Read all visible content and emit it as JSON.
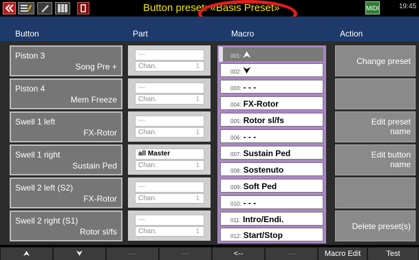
{
  "topbar": {
    "title_prefix": "Button preset: ",
    "preset_name": "«Basis Preset»",
    "b1_label": "",
    "b2_label": "EDIT",
    "b3_label": "",
    "right_icon": "MIDI",
    "clock": "19:45"
  },
  "headers": {
    "button": "Button",
    "part": "Part",
    "macro": "Macro",
    "action": "Action"
  },
  "buttons": [
    {
      "name": "Piston 3",
      "func": "Song Pre +"
    },
    {
      "name": "Piston 4",
      "func": "Mem Freeze"
    },
    {
      "name": "Swell 1 left",
      "func": "FX-Rotor"
    },
    {
      "name": "Swell 1 right",
      "func": "Sustain Ped"
    },
    {
      "name": "Swell 2 left  (S2)",
      "func": "FX-Rotor"
    },
    {
      "name": "Swell 2 right (S1)",
      "func": "Rotor sl/fs"
    }
  ],
  "parts": [
    {
      "part": "---",
      "chan": "Chan.",
      "num": "1"
    },
    {
      "part": "---",
      "chan": "Chan.",
      "num": "1"
    },
    {
      "part": "---",
      "chan": "Chan.",
      "num": "1"
    },
    {
      "part": "all Master",
      "chan": "Chan.",
      "num": "1"
    },
    {
      "part": "---",
      "chan": "Chan.",
      "num": "1"
    },
    {
      "part": "---",
      "chan": "Chan.",
      "num": "1"
    }
  ],
  "macros": [
    {
      "num": "001:",
      "text": "⮝"
    },
    {
      "num": "002:",
      "text": "⮟"
    },
    {
      "num": "003:",
      "text": " - - -"
    },
    {
      "num": "004:",
      "text": "FX-Rotor"
    },
    {
      "num": "005:",
      "text": "Rotor sl/fs"
    },
    {
      "num": "006:",
      "text": " - - -"
    },
    {
      "num": "007:",
      "text": "Sustain Ped"
    },
    {
      "num": "008:",
      "text": "Sostenuto"
    },
    {
      "num": "009:",
      "text": "Soft Ped"
    },
    {
      "num": "010:",
      "text": " - - -"
    },
    {
      "num": "011:",
      "text": "Intro/Endi."
    },
    {
      "num": "012:",
      "text": "Start/Stop"
    }
  ],
  "actions": {
    "change_preset": "Change preset",
    "empty1": "",
    "edit_preset_name_1": "Edit preset",
    "edit_preset_name_2": "name",
    "edit_button_name_1": "Edit button",
    "edit_button_name_2": "name",
    "empty2": "",
    "delete_preset": "Delete preset(s)"
  },
  "bottombar": {
    "up": "⮝",
    "down": "⮟",
    "d1": "---",
    "d2": "---",
    "back": "<--",
    "d3": "---",
    "macro_edit": "Macro Edit",
    "test": "Test"
  }
}
